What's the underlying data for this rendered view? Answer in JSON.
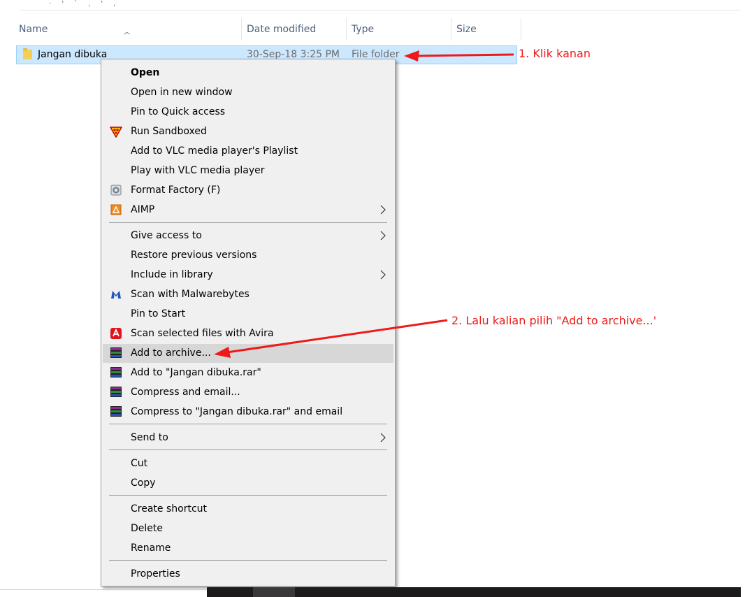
{
  "breadcrumb_fragment": "· ' ` ˌ ' ,",
  "columns": {
    "name": "Name",
    "date_modified": "Date modified",
    "type": "Type",
    "size": "Size"
  },
  "file": {
    "name": "Jangan dibuka",
    "date": "30-Sep-18 3:25 PM",
    "type": "File folder"
  },
  "menu": {
    "open": "Open",
    "open_new_window": "Open in new window",
    "pin_quick_access": "Pin to Quick access",
    "run_sandboxed": "Run Sandboxed",
    "add_vlc_playlist": "Add to VLC media player's Playlist",
    "play_vlc": "Play with VLC media player",
    "format_factory": "Format Factory (F)",
    "aimp": "AIMP",
    "give_access": "Give access to",
    "restore_versions": "Restore previous versions",
    "include_library": "Include in library",
    "scan_malwarebytes": "Scan with Malwarebytes",
    "pin_start": "Pin to Start",
    "scan_avira": "Scan selected files with Avira",
    "add_archive": "Add to archive...",
    "add_rar": "Add to \"Jangan dibuka.rar\"",
    "compress_email": "Compress and email...",
    "compress_rar_email": "Compress to \"Jangan dibuka.rar\" and email",
    "send_to": "Send to",
    "cut": "Cut",
    "copy": "Copy",
    "create_shortcut": "Create shortcut",
    "delete": "Delete",
    "rename": "Rename",
    "properties": "Properties"
  },
  "annotations": {
    "step1": "1. Klik kanan",
    "step2": "2. Lalu kalian pilih \"Add to archive...'"
  },
  "colors": {
    "selection": "#cce8ff",
    "annotation": "#ee1a1a",
    "menu_bg": "#f0f0f0",
    "menu_highlight": "#d7d7d7"
  }
}
